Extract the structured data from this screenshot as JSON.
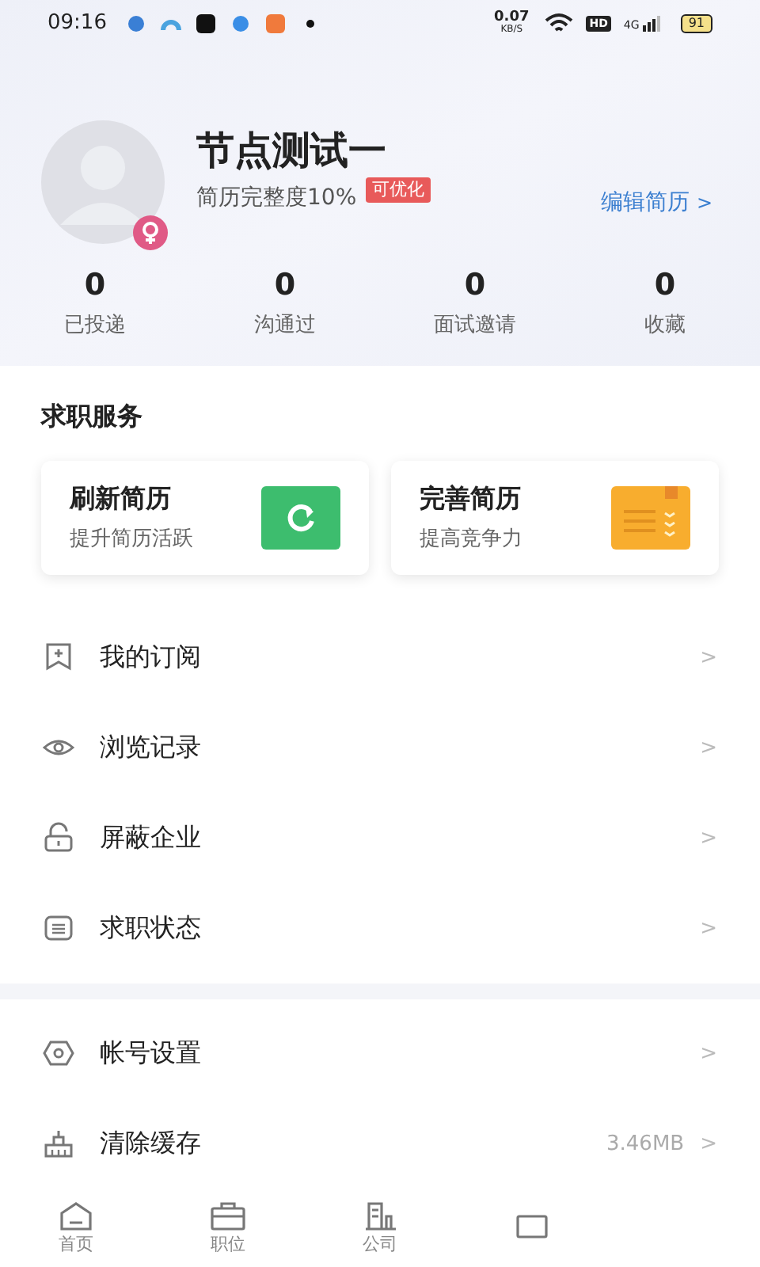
{
  "status_bar": {
    "time": "09:16",
    "net_speed": "0.07",
    "net_unit": "KB/S",
    "hd": "HD",
    "network": "4G",
    "battery": "91"
  },
  "profile": {
    "name": "节点测试一",
    "completeness": "简历完整度10%",
    "badge": "可优化",
    "edit_link": "编辑简历",
    "edit_caret": ">"
  },
  "stats": [
    {
      "value": "0",
      "label": "已投递"
    },
    {
      "value": "0",
      "label": "沟通过"
    },
    {
      "value": "0",
      "label": "面试邀请"
    },
    {
      "value": "0",
      "label": "收藏"
    }
  ],
  "services": {
    "title": "求职服务",
    "cards": [
      {
        "kind": "refresh",
        "title": "刷新简历",
        "subtitle": "提升简历活跃"
      },
      {
        "kind": "improve",
        "title": "完善简历",
        "subtitle": "提高竞争力"
      }
    ]
  },
  "menu_groups": [
    [
      {
        "kind": "subscribe",
        "label": "我的订阅",
        "caret": ">"
      },
      {
        "kind": "history",
        "label": "浏览记录",
        "caret": ">"
      },
      {
        "kind": "block",
        "label": "屏蔽企业",
        "caret": ">"
      },
      {
        "kind": "status",
        "label": "求职状态",
        "caret": ">"
      }
    ],
    [
      {
        "kind": "settings",
        "label": "帐号设置",
        "caret": ">"
      },
      {
        "kind": "cache",
        "label": "清除缓存",
        "value": "3.46MB",
        "caret": ">"
      }
    ]
  ],
  "tab_bar": [
    {
      "kind": "home",
      "label": "首页",
      "selected": false
    },
    {
      "kind": "jobs",
      "label": "职位",
      "selected": false
    },
    {
      "kind": "company",
      "label": "公司",
      "selected": false
    },
    {
      "kind": "messages",
      "selected": false
    }
  ]
}
